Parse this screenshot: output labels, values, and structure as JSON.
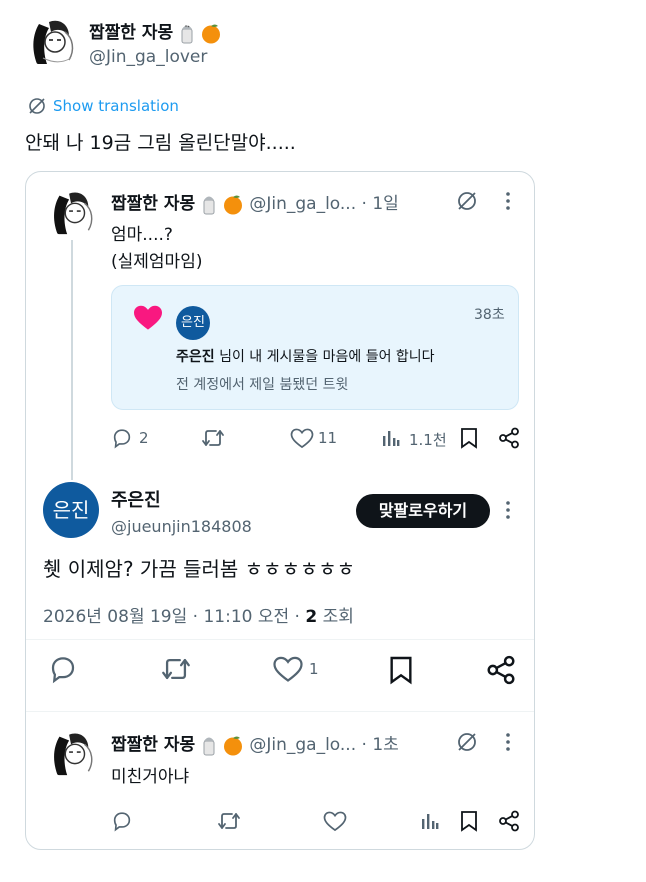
{
  "top_tweet": {
    "display_name": "짭짤한 자몽",
    "handle": "@Jin_ga_lover",
    "show_translation": "Show translation",
    "text": "안돼 나 19금 그림 올린단말야....."
  },
  "quoted_tweet": {
    "display_name": "짭짤한 자몽",
    "handle": "@Jin_ga_lo...",
    "time": "1일",
    "line1": "엄마....?",
    "line2": "(실제엄마임)",
    "notification": {
      "avatar_text": "은진",
      "time": "38초",
      "actor": "주은진",
      "action": " 님이 내 게시물을 마음에 들어 합니다",
      "sub": "전 계정에서 제일 붐됐던 트윗"
    },
    "actions": {
      "replies": "2",
      "likes": "11",
      "views": "1.1천"
    }
  },
  "main_tweet": {
    "avatar_text": "은진",
    "display_name": "주은진",
    "handle": "@jueunjin184808",
    "follow_label": "맞팔로우하기",
    "text": "췟 이제암? 가끔 들러봄 ㅎㅎㅎㅎㅎㅎ",
    "date": "2026년 08월 19일 · 11:10 오전",
    "dot": " · ",
    "views_count": "2",
    "views_label": " 조회",
    "like_count": "1"
  },
  "reply_tweet": {
    "display_name": "짭짤한 자몽",
    "handle": "@Jin_ga_lo...",
    "time": "1초",
    "text": "미친거아냐"
  },
  "colors": {
    "text": "#0f1419",
    "muted": "#536471",
    "accent": "#1d9bf0",
    "avatar_blue": "#0f5a9e",
    "heart": "#f91880",
    "card_border": "#cfd9de",
    "notification_bg": "#e8f5fd"
  }
}
